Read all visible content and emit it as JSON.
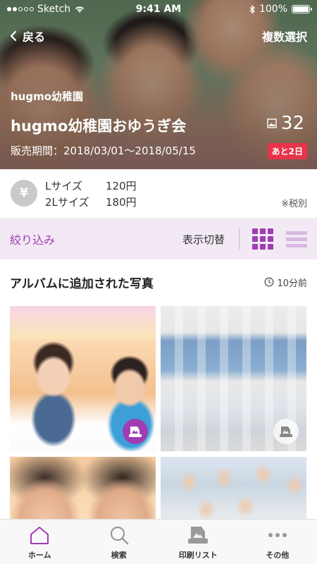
{
  "status_bar": {
    "carrier": "Sketch",
    "time": "9:41 AM",
    "battery": "100%"
  },
  "nav": {
    "back_label": "戻る",
    "multi_select_label": "複数選択"
  },
  "album": {
    "school_name": "hugmo幼稚園",
    "event_title": "hugmo幼稚園おゆうぎ会",
    "sale_period": "販売期間：2018/03/01～2018/05/15",
    "photo_count": "32",
    "days_left": "あと2日"
  },
  "pricing": {
    "currency_symbol": "¥",
    "rows": [
      {
        "size": "Lサイズ",
        "price": "120円"
      },
      {
        "size": "2Lサイズ",
        "price": "180円"
      }
    ],
    "tax_note": "※税別"
  },
  "filter": {
    "filter_label": "絞り込み",
    "display_toggle_label": "表示切替",
    "active_view": "grid"
  },
  "section": {
    "title": "アルバムに追加された写真",
    "updated": "10分前"
  },
  "photos": [
    {
      "subject": "Two children playing with toy bananas",
      "in_print_list": true
    },
    {
      "subject": "Class group photo of children seated",
      "in_print_list": false
    },
    {
      "subject": "Close-up of two children",
      "in_print_list": false
    },
    {
      "subject": "Group of smiling children",
      "in_print_list": false
    }
  ],
  "tabs": [
    {
      "label": "ホーム",
      "icon": "home-icon",
      "active": true
    },
    {
      "label": "検索",
      "icon": "search-icon",
      "active": false
    },
    {
      "label": "印刷リスト",
      "icon": "print-list-icon",
      "active": false
    },
    {
      "label": "その他",
      "icon": "more-icon",
      "active": false
    }
  ],
  "colors": {
    "accent": "#a03db2",
    "badge_red": "#e8334a",
    "filter_bg": "#f2e9f4"
  }
}
